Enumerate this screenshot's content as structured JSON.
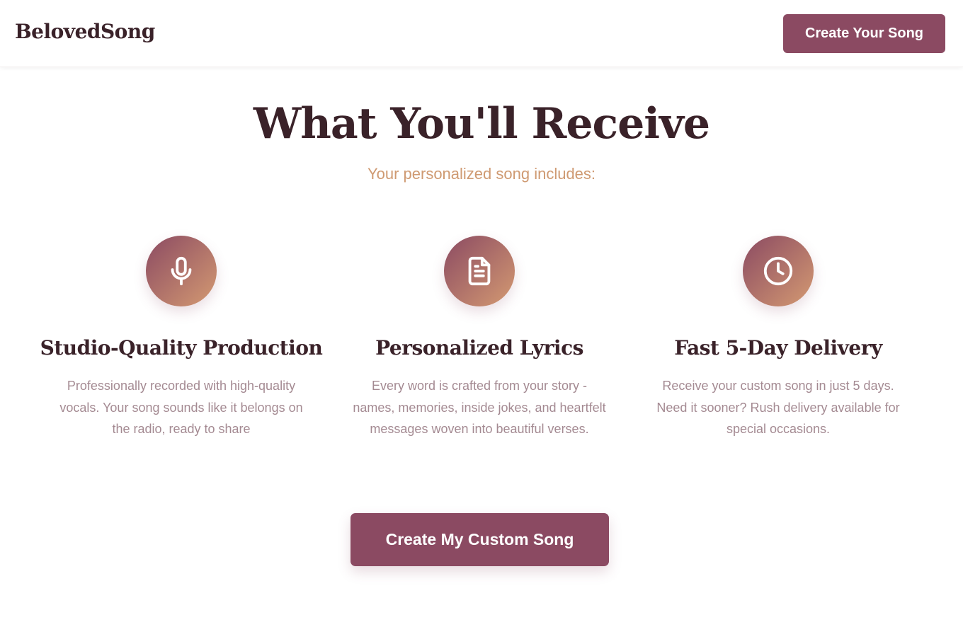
{
  "header": {
    "logo": "BelovedSong",
    "cta_label": "Create Your Song"
  },
  "section": {
    "title": "What You'll Receive",
    "subtitle": "Your personalized song includes:"
  },
  "features": [
    {
      "icon": "microphone-icon",
      "title": "Studio-Quality Production",
      "description": "Professionally recorded with high-quality vocals. Your song sounds like it belongs on the radio, ready to share"
    },
    {
      "icon": "document-icon",
      "title": "Personalized Lyrics",
      "description": "Every word is crafted from your story - names, memories, inside jokes, and heartfelt messages woven into beautiful verses."
    },
    {
      "icon": "clock-icon",
      "title": "Fast 5-Day Delivery",
      "description": "Receive your custom song in just 5 days. Need it sooner? Rush delivery available for special occasions."
    }
  ],
  "main_cta": {
    "label": "Create My Custom Song"
  },
  "colors": {
    "brand": "#8b4a62",
    "accent": "#cf9a72",
    "heading": "#3a2229",
    "body_text": "#a48a92",
    "icon_gradient_start": "#8b4a62",
    "icon_gradient_end": "#d49a72"
  }
}
